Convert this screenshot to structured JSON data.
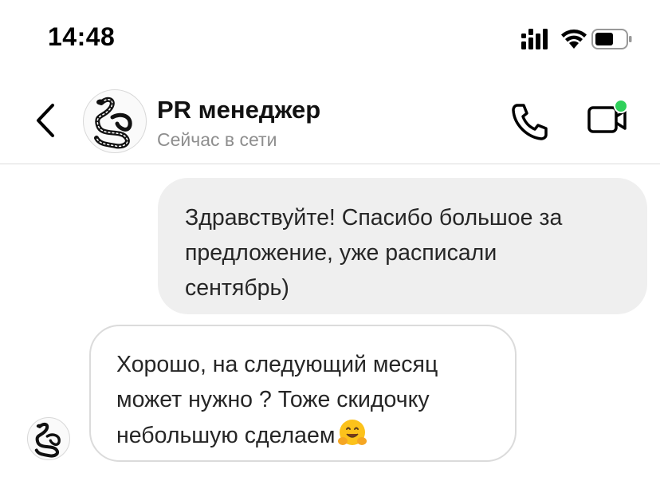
{
  "status_bar": {
    "time": "14:48",
    "icons": [
      "signal-icon",
      "wifi-icon",
      "battery-icon"
    ]
  },
  "header": {
    "contact_name": "PR менеджер",
    "contact_status": "Сейчас в сети",
    "avatar_icon": "snake-avatar-icon",
    "back_icon": "chevron-left-icon",
    "call_icon": "phone-icon",
    "video_icon": "video-camera-icon",
    "online_indicator_color": "#2fd05a"
  },
  "messages": [
    {
      "direction": "outgoing",
      "text": "Здравствуйте! Спасибо большое за\nпредложение, уже расписали\nсентябрь)"
    },
    {
      "direction": "incoming",
      "text": "Хорошо, на следующий месяц\nможет нужно ? Тоже скидочку\nнебольшую сделаем",
      "emoji": "hugging-face-emoji"
    }
  ],
  "colors": {
    "outgoing_bubble": "#efefef",
    "incoming_border": "#dbdbdb",
    "status_text": "#8e8e8e"
  }
}
